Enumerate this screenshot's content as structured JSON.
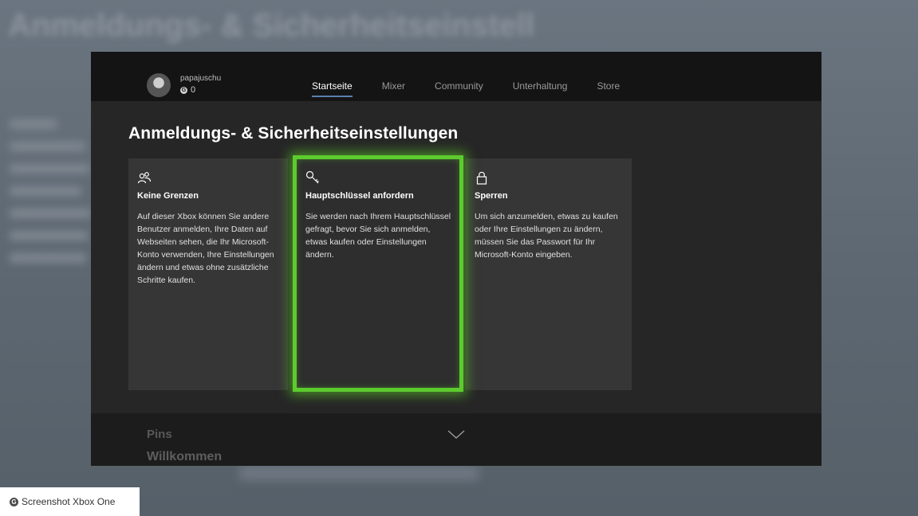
{
  "header": {
    "username": "papajuschu",
    "gamerscore": "0",
    "nav": [
      {
        "label": "Startseite",
        "active": true
      },
      {
        "label": "Mixer",
        "active": false
      },
      {
        "label": "Community",
        "active": false
      },
      {
        "label": "Unterhaltung",
        "active": false
      },
      {
        "label": "Store",
        "active": false
      }
    ]
  },
  "page_title": "Anmeldungs- & Sicherheitseinstellungen",
  "options": [
    {
      "icon": "people-icon",
      "title": "Keine Grenzen",
      "description": "Auf dieser Xbox können Sie andere Benutzer anmelden, Ihre Daten auf Webseiten sehen, die Ihr Microsoft-Konto verwenden, Ihre Einstellungen ändern und etwas ohne zusätzliche Schritte kaufen."
    },
    {
      "icon": "key-icon",
      "title": "Hauptschlüssel anfordern",
      "description": "Sie werden nach Ihrem Hauptschlüssel gefragt, bevor Sie sich anmelden, etwas kaufen oder Einstellungen ändern.",
      "focused": true
    },
    {
      "icon": "lock-icon",
      "title": "Sperren",
      "description": "Um sich anzumelden, etwas zu kaufen oder Ihre Einstellungen zu ändern, müssen Sie das Passwort für Ihr Microsoft-Konto eingeben."
    }
  ],
  "bottom": {
    "pins_label": "Pins",
    "welcome_label": "Willkommen"
  },
  "credit": "Screenshot Xbox One",
  "colors": {
    "focus": "#5dcb2e",
    "nav_underline": "#5a7fb0"
  }
}
